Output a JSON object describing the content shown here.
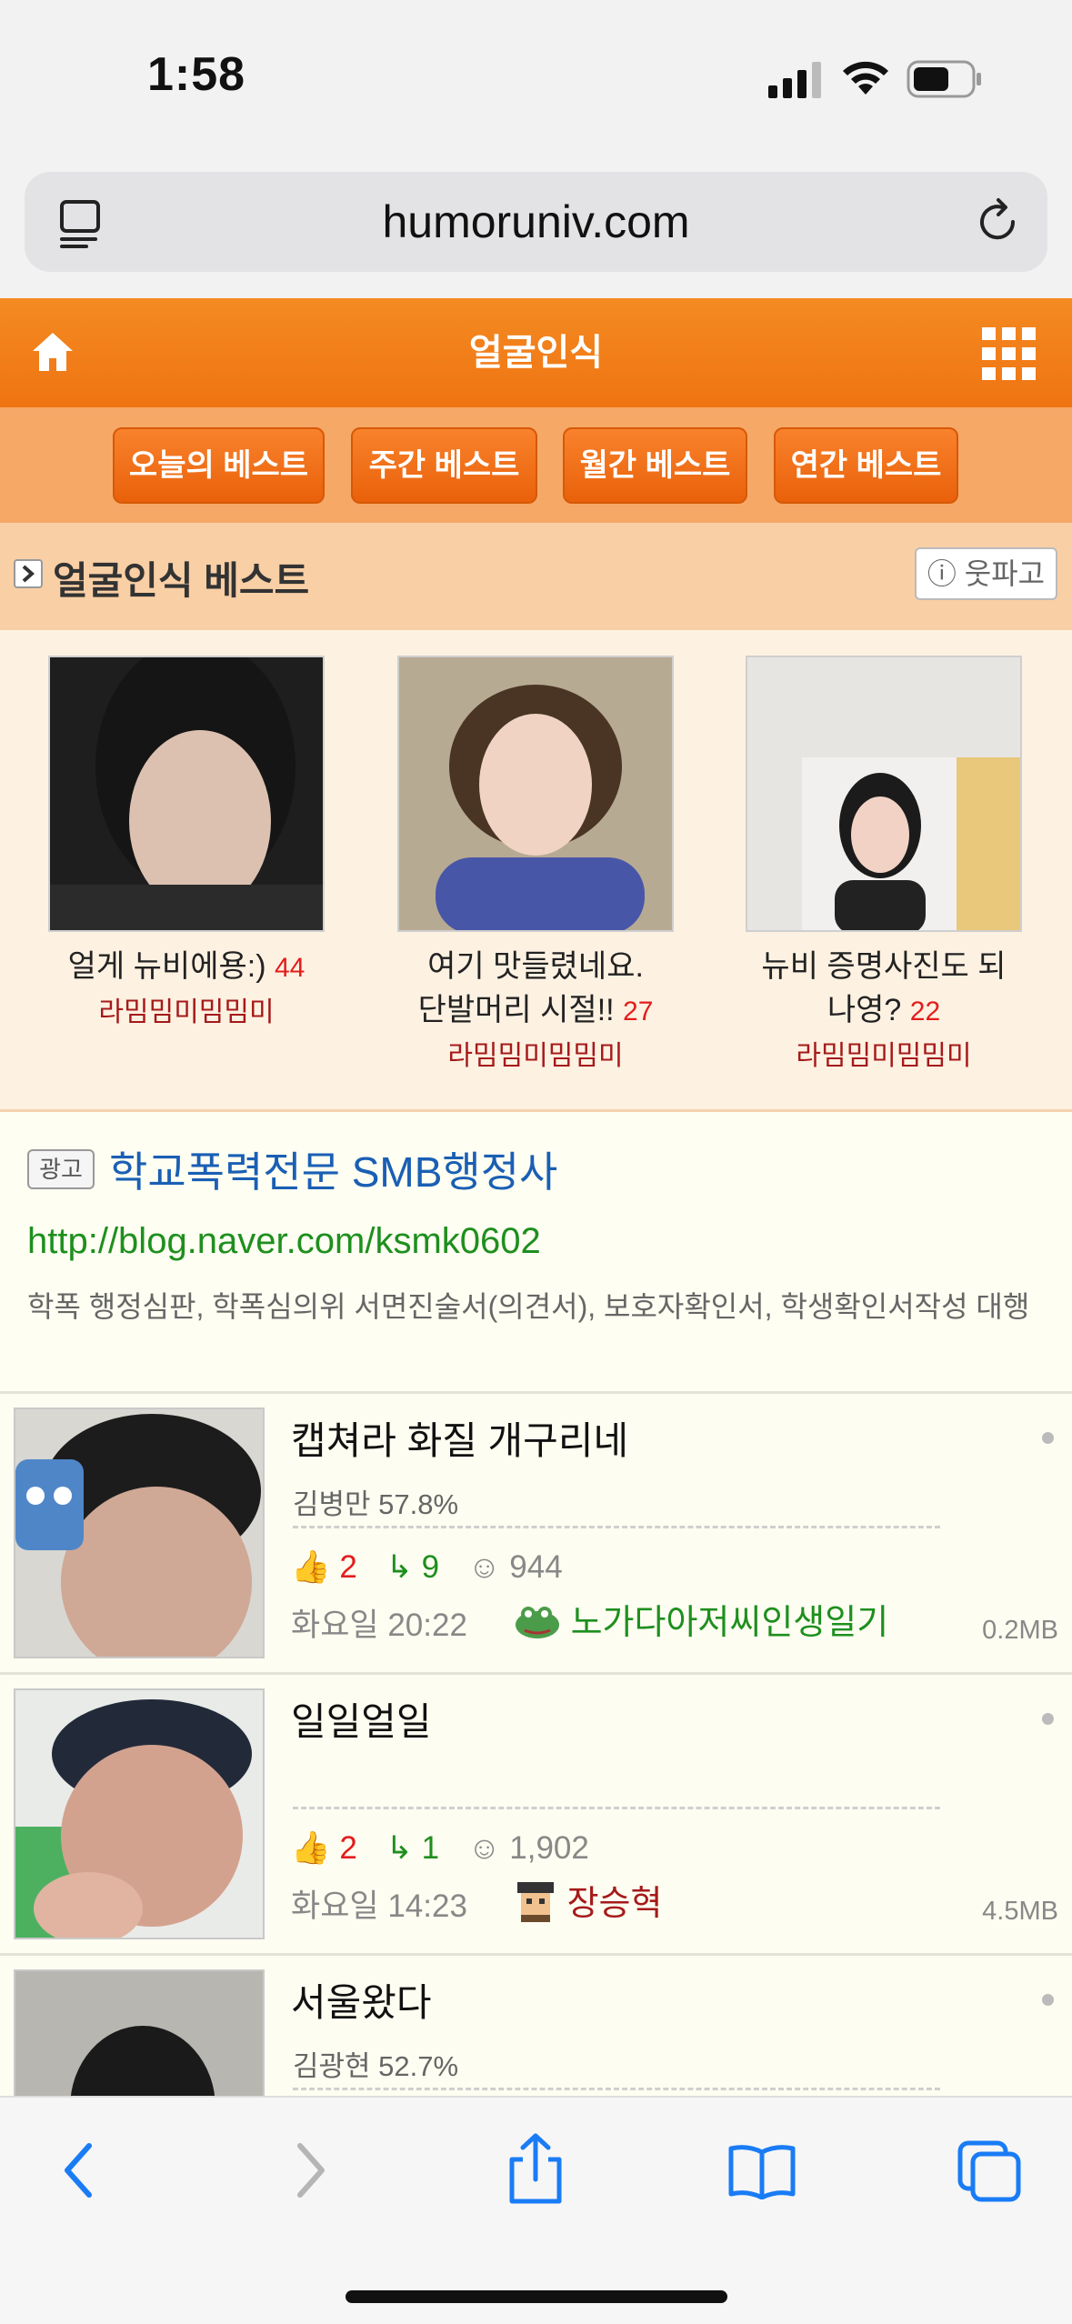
{
  "status": {
    "time": "1:58"
  },
  "browser": {
    "url": "humoruniv.com"
  },
  "header": {
    "title": "얼굴인식"
  },
  "tabs": [
    "오늘의 베스트",
    "주간 베스트",
    "월간 베스트",
    "연간 베스트"
  ],
  "best": {
    "title": "얼굴인식 베스트",
    "info_label": "ⓘ 웃파고",
    "items": [
      {
        "caption_line1": "얼게 뉴비에용:)",
        "caption_line2": "",
        "count": "44",
        "author": "라밈밈미밈밈미"
      },
      {
        "caption_line1": "여기 맛들렸네요.",
        "caption_line2": "단발머리 시절!!",
        "count": "27",
        "author": "라밈밈미밈밈미"
      },
      {
        "caption_line1": "뉴비 증명사진도 되",
        "caption_line2": "나영?",
        "count": "22",
        "author": "라밈밈미밈밈미"
      }
    ]
  },
  "ad": {
    "badge": "광고",
    "title": "학교폭력전문 SMB행정사",
    "url": "http://blog.naver.com/ksmk0602",
    "desc": "학폭 행정심판, 학폭심의위 서면진술서(의견서), 보호자확인서, 학생확인서작성 대행"
  },
  "posts": [
    {
      "title": "캡쳐라 화질 개구리네",
      "sub": "김병만 57.8%",
      "likes": "2",
      "replies": "9",
      "views": "944",
      "time": "화요일 20:22",
      "author": "노가다아저씨인생일기",
      "author_color": "#1e8f1e",
      "size": "0.2MB"
    },
    {
      "title": "일일얼일",
      "sub": "",
      "likes": "2",
      "replies": "1",
      "views": "1,902",
      "time": "화요일 14:23",
      "author": "장승혁",
      "author_color": "#a51a1a",
      "size": "4.5MB"
    },
    {
      "title": "서울왔다",
      "sub": "김광현 52.7%",
      "likes": "",
      "replies": "",
      "views": "",
      "time": "",
      "author": "",
      "author_color": "#1e8f1e",
      "size": ""
    }
  ],
  "icons": {
    "home": "home-icon",
    "grid": "grid-menu-icon",
    "reader": "reader-icon",
    "reload": "reload-icon",
    "back": "back-icon",
    "forward": "forward-icon",
    "share": "share-icon",
    "bookmarks": "bookmarks-icon",
    "tabs": "tabs-icon"
  },
  "colors": {
    "header_orange": "#ef7412",
    "link_blue": "#1a5fb4",
    "safari_blue": "#1a7cf5"
  }
}
